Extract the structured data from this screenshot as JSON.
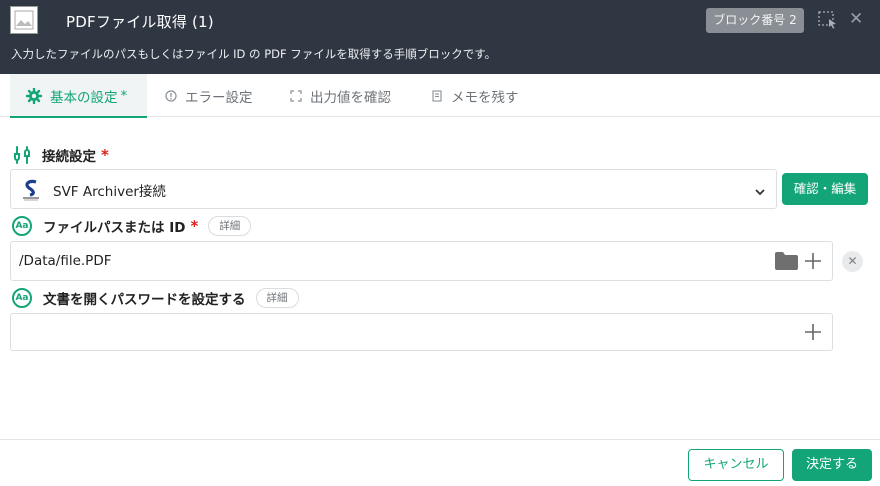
{
  "header": {
    "title": "PDFファイル取得 (1)",
    "description": "入力したファイルのパスもしくはファイル ID の PDF ファイルを取得する手順ブロックです。",
    "block_badge": "ブロック番号 2",
    "close": "✕"
  },
  "tabs": [
    {
      "label": "基本の設定",
      "required_mark": "*",
      "icon": "gear-icon",
      "active": true
    },
    {
      "label": "エラー設定",
      "icon": "alert-icon",
      "active": false
    },
    {
      "label": "出力値を確認",
      "icon": "expand-icon",
      "active": false
    },
    {
      "label": "メモを残す",
      "icon": "memo-icon",
      "active": false
    }
  ],
  "connection": {
    "label": "接続設定",
    "required_mark": "*",
    "selected_value": "SVF Archiver接続",
    "confirm_button": "確認・編集"
  },
  "file_path": {
    "label": "ファイルパスまたは ID",
    "required_mark": "*",
    "detail_chip": "詳細",
    "value": "/Data/file.PDF",
    "clear": "✕"
  },
  "password": {
    "label": "文書を開くパスワードを設定する",
    "detail_chip": "詳細",
    "value": ""
  },
  "footer": {
    "cancel_button": "キャンセル",
    "ok_button": "決定する"
  },
  "colors": {
    "accent": "#13a578",
    "header_bg": "#2f3742",
    "required": "#d9221c"
  }
}
